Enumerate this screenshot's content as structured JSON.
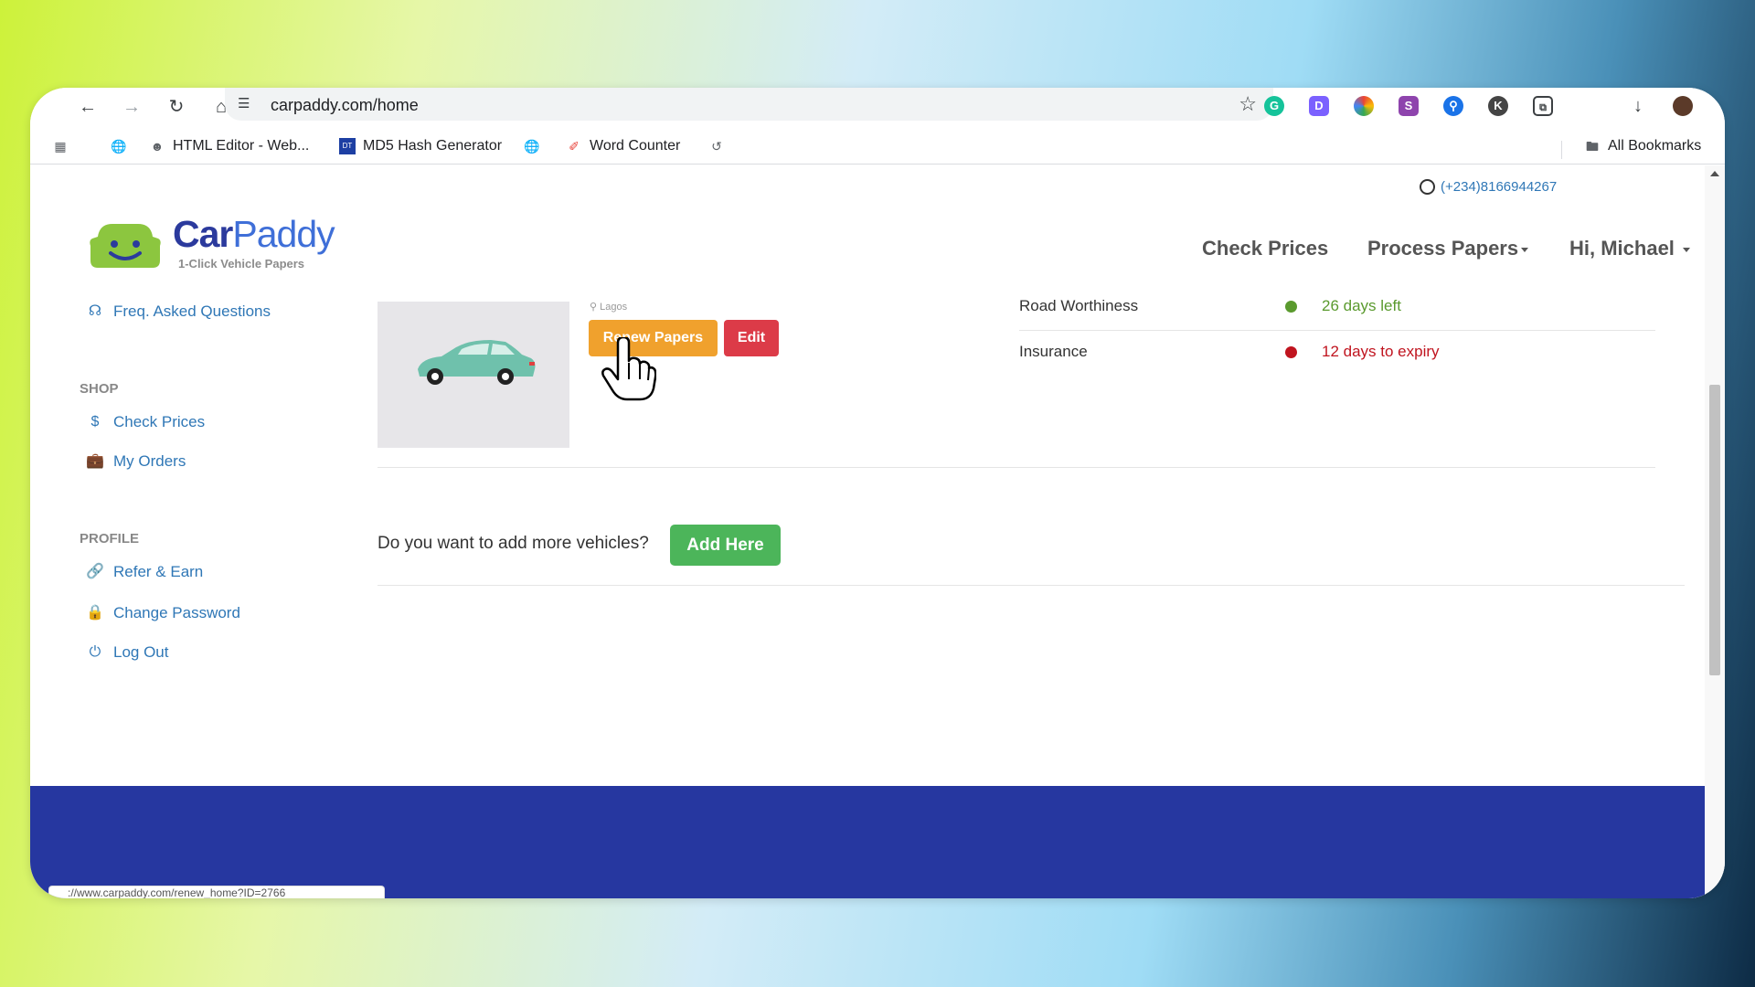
{
  "browser": {
    "url": "carpaddy.com/home",
    "bookmarks": [
      {
        "label": "HTML Editor - Web...",
        "icon": "person-icon"
      },
      {
        "label": "MD5 Hash Generator",
        "icon": "dans-tools-icon"
      },
      {
        "label": "Word Counter",
        "icon": "word-counter-icon"
      }
    ],
    "all_bookmarks_label": "All Bookmarks",
    "status_bar_url": "://www.carpaddy.com/renew_home?ID=2766"
  },
  "header": {
    "phone": "(+234)8166944267",
    "logo": {
      "name_part1": "Car",
      "name_part2": "Paddy",
      "tagline": "1-Click Vehicle Papers"
    },
    "nav": {
      "check_prices": "Check Prices",
      "process_papers": "Process Papers",
      "user_greeting": "Hi, Michael"
    }
  },
  "sidebar": {
    "faq": "Freq. Asked Questions",
    "shop_heading": "SHOP",
    "shop_items": [
      "Check Prices",
      "My Orders"
    ],
    "profile_heading": "PROFILE",
    "profile_items": [
      "Refer & Earn",
      "Change Password",
      "Log Out"
    ]
  },
  "vehicle": {
    "location": "Lagos",
    "renew_label": "Renew Papers",
    "edit_label": "Edit",
    "statuses": [
      {
        "name": "Road Worthiness",
        "value": "26 days left",
        "color": "#5a9a2e"
      },
      {
        "name": "Insurance",
        "value": "12 days to expiry",
        "color": "#c0141f"
      }
    ]
  },
  "add_vehicle": {
    "question": "Do you want to add more vehicles?",
    "button": "Add Here"
  },
  "colors": {
    "brand_blue": "#2637a0",
    "renew_orange": "#f0a12d",
    "edit_red": "#dc3b48",
    "add_green": "#4cb55a"
  }
}
